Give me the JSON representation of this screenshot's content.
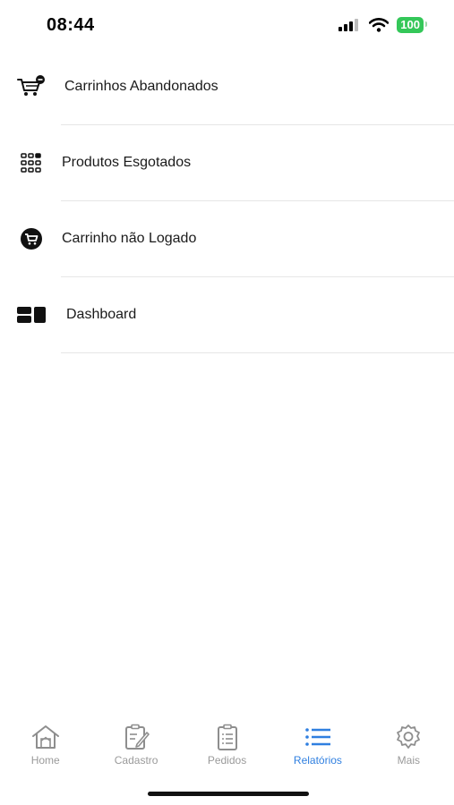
{
  "status_bar": {
    "time": "08:44",
    "battery": "100"
  },
  "menu": {
    "items": [
      {
        "label": "Carrinhos Abandonados",
        "icon": "cart-minus-icon"
      },
      {
        "label": "Produtos Esgotados",
        "icon": "grid-icon"
      },
      {
        "label": "Carrinho não Logado",
        "icon": "cart-circle-icon"
      },
      {
        "label": "Dashboard",
        "icon": "dashboard-icon"
      }
    ]
  },
  "tab_bar": {
    "active": "Relatórios",
    "active_color": "#2f7fe0",
    "inactive_color": "#9a9a9a",
    "tabs": [
      {
        "label": "Home",
        "icon": "home-icon"
      },
      {
        "label": "Cadastro",
        "icon": "edit-icon"
      },
      {
        "label": "Pedidos",
        "icon": "clipboard-icon"
      },
      {
        "label": "Relatórios",
        "icon": "list-icon"
      },
      {
        "label": "Mais",
        "icon": "gear-icon"
      }
    ]
  }
}
